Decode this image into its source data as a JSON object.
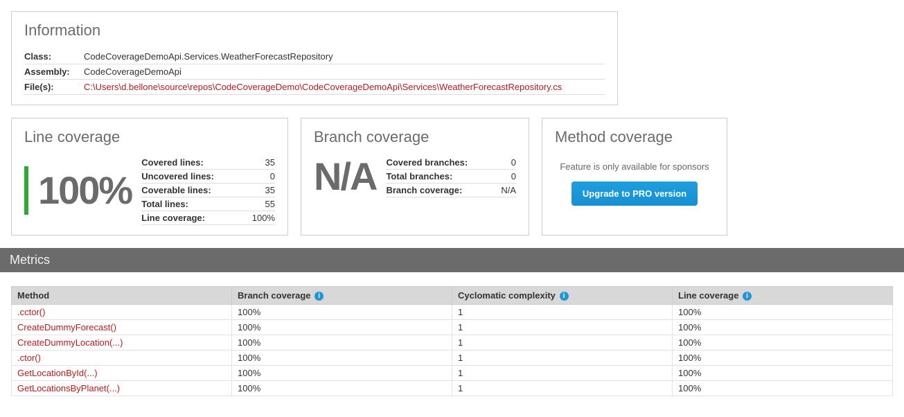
{
  "info": {
    "title": "Information",
    "labels": {
      "class": "Class:",
      "assembly": "Assembly:",
      "files": "File(s):"
    },
    "class": "CodeCoverageDemoApi.Services.WeatherForecastRepository",
    "assembly": "CodeCoverageDemoApi",
    "file": "C:\\Users\\d.bellone\\source\\repos\\CodeCoverageDemo\\CodeCoverageDemoApi\\Services\\WeatherForecastRepository.cs"
  },
  "line_cov": {
    "title": "Line coverage",
    "pct": "100%",
    "rows": [
      {
        "k": "Covered lines:",
        "v": "35"
      },
      {
        "k": "Uncovered lines:",
        "v": "0"
      },
      {
        "k": "Coverable lines:",
        "v": "35"
      },
      {
        "k": "Total lines:",
        "v": "55"
      },
      {
        "k": "Line coverage:",
        "v": "100%"
      }
    ]
  },
  "branch_cov": {
    "title": "Branch coverage",
    "pct": "N/A",
    "rows": [
      {
        "k": "Covered branches:",
        "v": "0"
      },
      {
        "k": "Total branches:",
        "v": "0"
      },
      {
        "k": "Branch coverage:",
        "v": "N/A"
      }
    ]
  },
  "method_cov": {
    "title": "Method coverage",
    "note": "Feature is only available for sponsors",
    "button": "Upgrade to PRO version"
  },
  "metrics": {
    "title": "Metrics",
    "headers": {
      "method": "Method",
      "branch": "Branch coverage",
      "cyclo": "Cyclomatic complexity",
      "line": "Line coverage"
    },
    "rows": [
      {
        "m": ".cctor()",
        "b": "100%",
        "c": "1",
        "l": "100%"
      },
      {
        "m": "CreateDummyForecast()",
        "b": "100%",
        "c": "1",
        "l": "100%"
      },
      {
        "m": "CreateDummyLocation(...)",
        "b": "100%",
        "c": "1",
        "l": "100%"
      },
      {
        "m": ".ctor()",
        "b": "100%",
        "c": "1",
        "l": "100%"
      },
      {
        "m": "GetLocationById(...)",
        "b": "100%",
        "c": "1",
        "l": "100%"
      },
      {
        "m": "GetLocationsByPlanet(...)",
        "b": "100%",
        "c": "1",
        "l": "100%"
      }
    ]
  }
}
